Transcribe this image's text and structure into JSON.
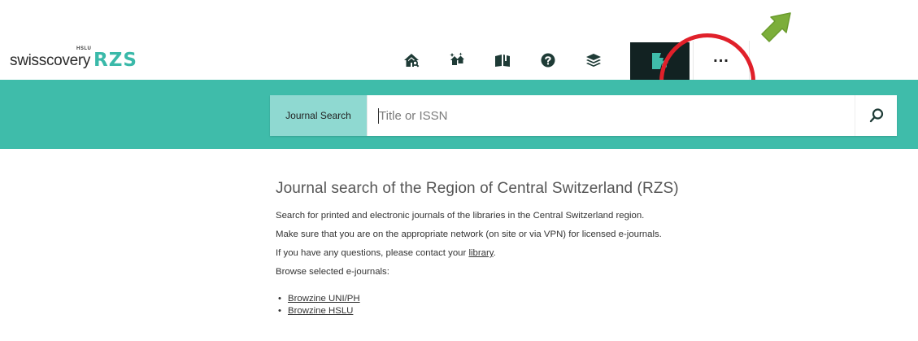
{
  "logo": {
    "name": "swisscovery",
    "badge": "HSLU",
    "suffix": "RZS"
  },
  "nav": {
    "items": [
      {
        "icon": "home-search-icon",
        "active": false
      },
      {
        "icon": "new-arrivals-icon",
        "active": false
      },
      {
        "icon": "open-book-icon",
        "active": false
      },
      {
        "icon": "help-icon",
        "active": false
      },
      {
        "icon": "layers-icon",
        "active": false
      },
      {
        "icon": "journal-search-icon",
        "active": true
      },
      {
        "icon": "more-icon",
        "active": false
      }
    ],
    "more_label": "..."
  },
  "colors": {
    "teal": "#3fbcaa",
    "scope_bg": "#8fd9d1",
    "active_nav": "#122222",
    "annotation_red": "#e0202a",
    "annotation_arrow": "#7cae3a"
  },
  "search": {
    "scope_label": "Journal Search",
    "placeholder": "Title or ISSN",
    "value": ""
  },
  "content": {
    "heading": "Journal search of the Region of Central Switzerland (RZS)",
    "p1": "Search for printed and electronic journals of the libraries in the Central Switzerland region.",
    "p2": "Make sure that you are on the appropriate network (on site or via VPN) for licensed e-journals.",
    "p3_before": "If you have any questions, please contact your ",
    "p3_link": "library",
    "p3_after": ".",
    "p4": "Browse selected e-journals:",
    "links": [
      "Browzine UNI/PH",
      "Browzine HSLU"
    ]
  }
}
